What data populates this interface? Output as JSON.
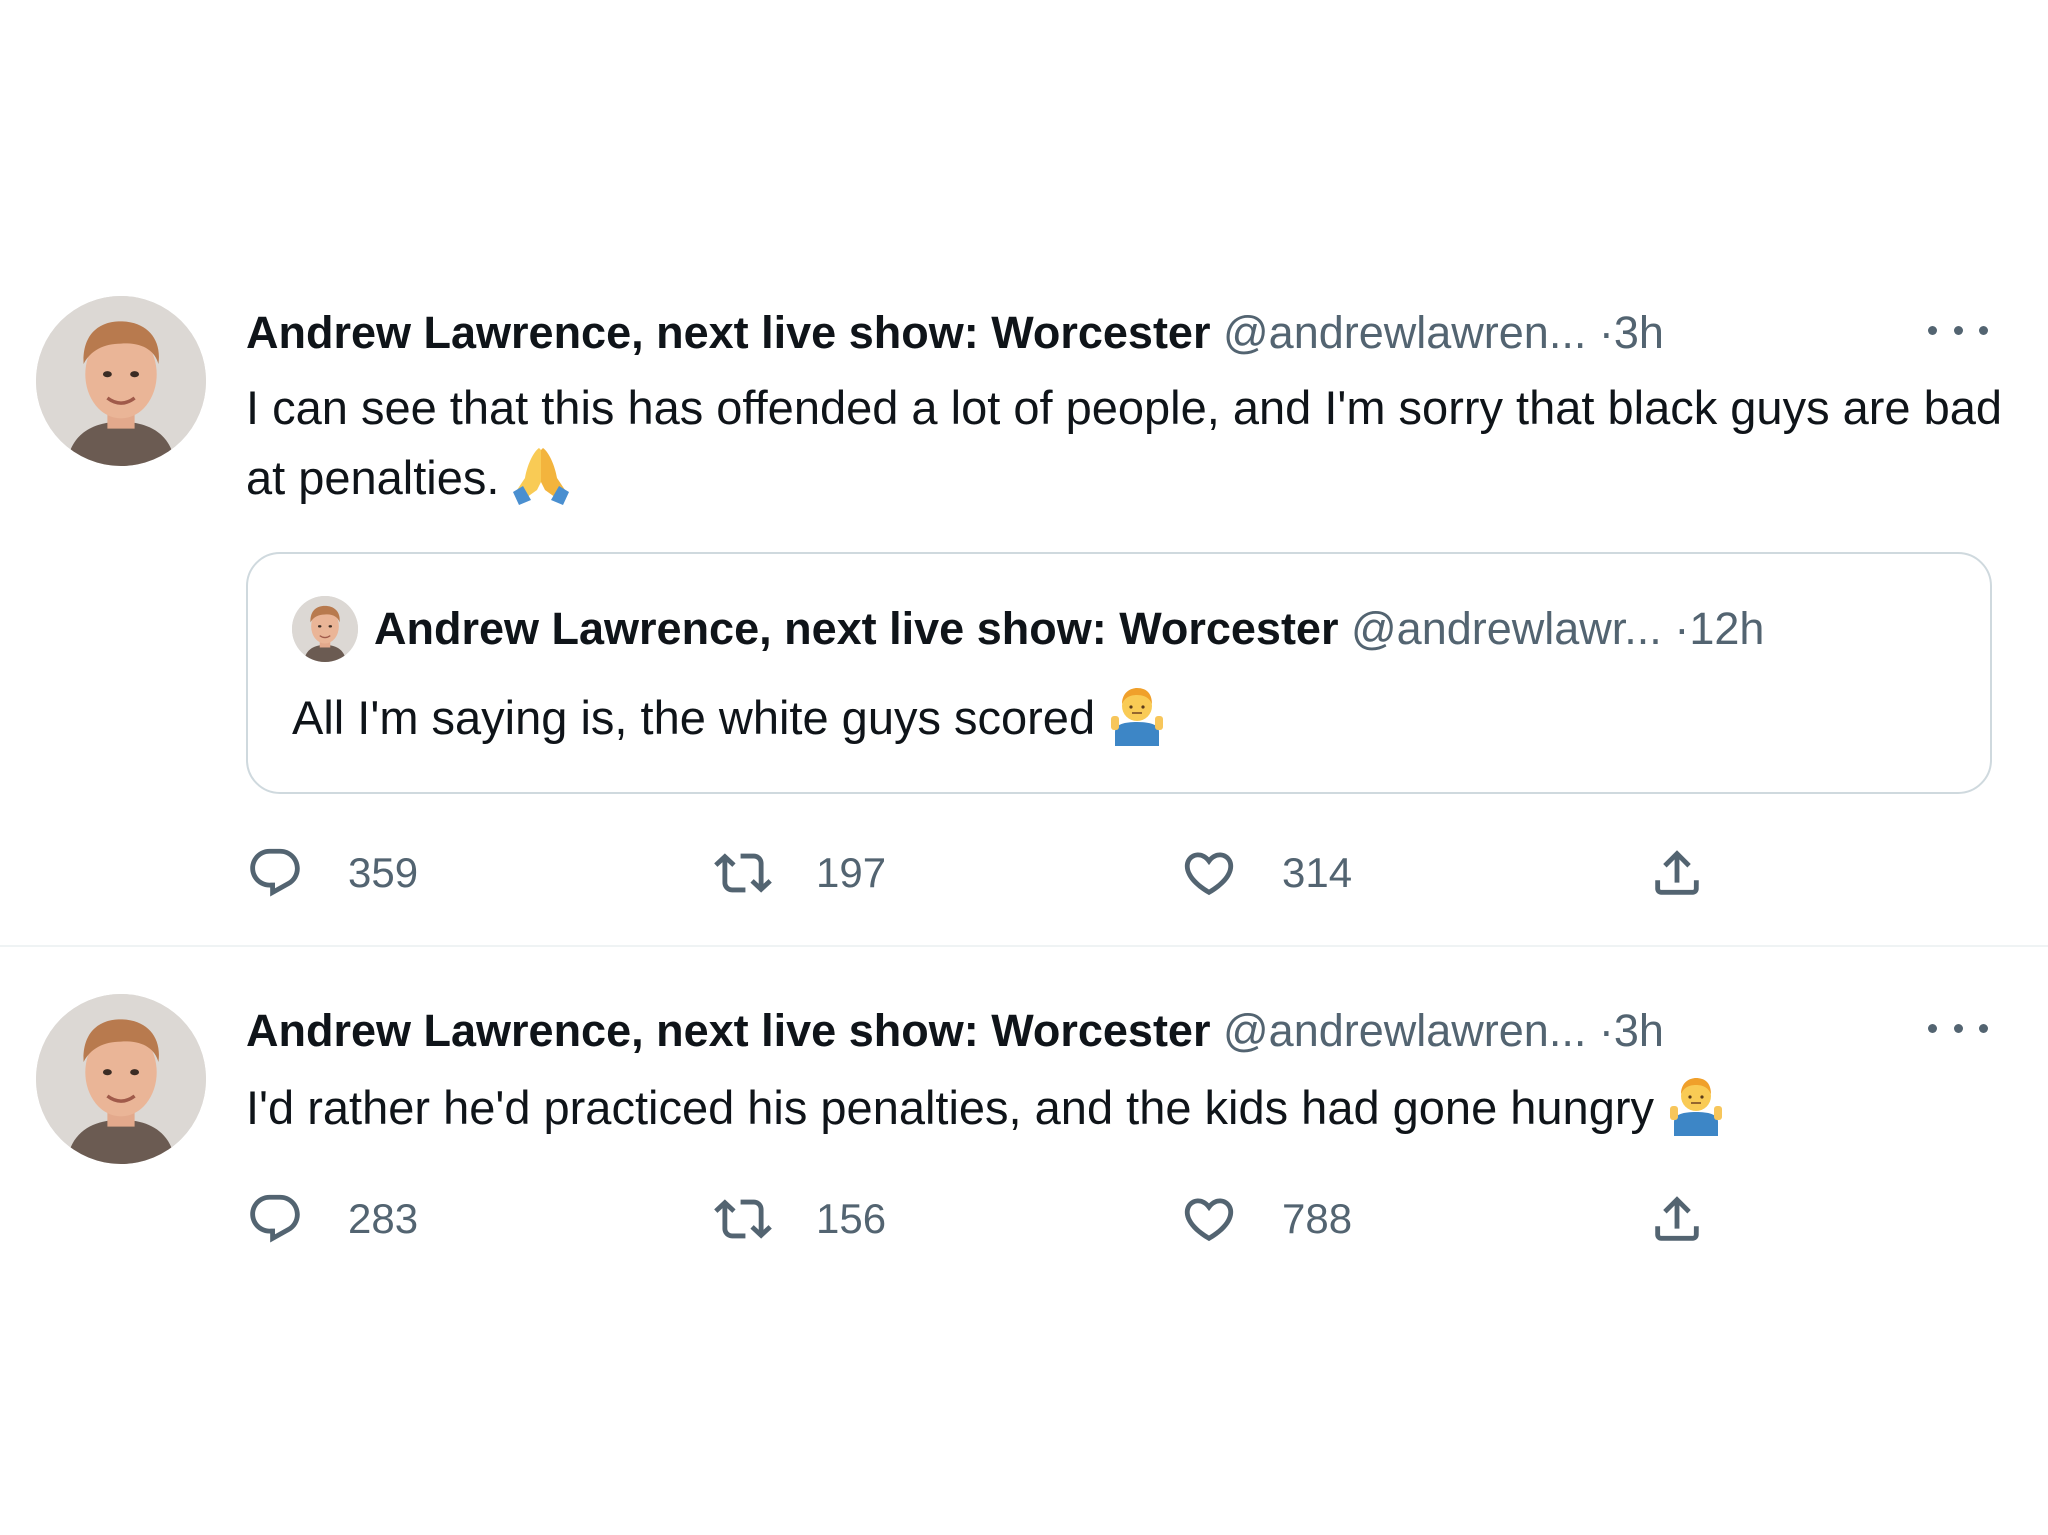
{
  "tweets": [
    {
      "author_name": "Andrew Lawrence, next live show: Worcester",
      "handle": "@andrewlawren...",
      "separator": "·",
      "time": "3h",
      "text": "I can see that this has offended a lot of people, and I'm sorry that black guys are bad at penalties.",
      "emoji": "folded-hands-emoji",
      "quoted": {
        "author_name": "Andrew Lawrence, next live show: Worcester",
        "handle": "@andrewlawr...",
        "separator": "·",
        "time": "12h",
        "text": "All I'm saying is, the white guys scored",
        "emoji": "man-shrugging-emoji"
      },
      "replies": "359",
      "retweets": "197",
      "likes": "314"
    },
    {
      "author_name": "Andrew Lawrence, next live show: Worcester",
      "handle": "@andrewlawren...",
      "separator": "·",
      "time": "3h",
      "text": "I'd rather he'd practiced his penalties, and the kids had gone hungry",
      "emoji": "man-shrugging-emoji",
      "replies": "283",
      "retweets": "156",
      "likes": "788"
    }
  ],
  "colors": {
    "text": "#0f1419",
    "secondary": "#536471",
    "border": "#cfd9de"
  }
}
